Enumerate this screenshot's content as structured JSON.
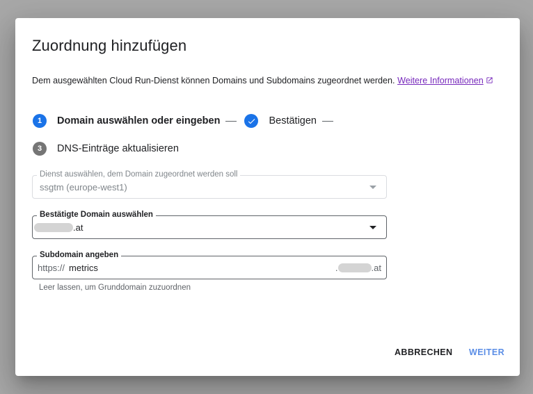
{
  "dialog": {
    "title": "Zuordnung hinzufügen",
    "description": "Dem ausgewählten Cloud Run-Dienst können Domains und Subdomains zugeordnet werden.",
    "more_info_link": "Weitere Informationen"
  },
  "steps": [
    {
      "number": "1",
      "label": "Domain auswählen oder eingeben",
      "state": "active"
    },
    {
      "number": "2",
      "label": "Bestätigen",
      "state": "done"
    },
    {
      "number": "3",
      "label": "DNS-Einträge aktualisieren",
      "state": "pending"
    }
  ],
  "service_field": {
    "label": "Dienst auswählen, dem Domain zugeordnet werden soll",
    "value": "ssgtm (europe-west1)"
  },
  "domain_field": {
    "label": "Bestätigte Domain auswählen",
    "value_suffix": ".at"
  },
  "subdomain_field": {
    "label": "Subdomain angeben",
    "prefix": "https://",
    "value": "metrics",
    "suffix_dot": ".",
    "suffix": ".at",
    "hint": "Leer lassen, um Grunddomain zuzuordnen"
  },
  "actions": {
    "cancel": "ABBRECHEN",
    "next": "WEITER"
  },
  "colors": {
    "accent": "#1a73e8",
    "link": "#7627bb",
    "next_button": "#5b8ee6"
  }
}
